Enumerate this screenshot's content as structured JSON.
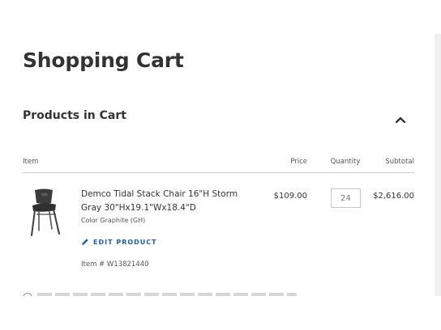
{
  "page": {
    "title": "Shopping Cart"
  },
  "cart": {
    "section_title": "Products in Cart",
    "toggle_icon": "chevron-up-icon",
    "columns": {
      "item": "Item",
      "price": "Price",
      "quantity": "Quantity",
      "subtotal": "Subtotal"
    },
    "items": [
      {
        "name": "Demco Tidal Stack Chair 16\"H Storm Gray 30\"Hx19.1\"Wx18.4\"D",
        "color": "Color Graphite (GH)",
        "edit_label": "EDIT PRODUCT",
        "item_number": "Item # W13821440",
        "price": "$109.00",
        "quantity": "24",
        "subtotal": "$2,616.00",
        "image_icon": "chair-icon"
      }
    ]
  },
  "colors": {
    "link": "#1f5fa8",
    "text": "#333333",
    "divider": "#cfcfcf"
  }
}
